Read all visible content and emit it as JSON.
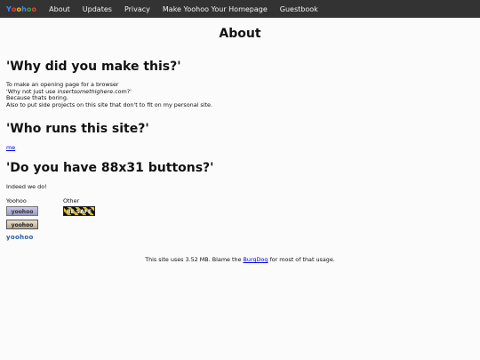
{
  "nav": {
    "brand_letters": [
      "Y",
      "o",
      "o",
      "h",
      "o",
      "o"
    ],
    "brand_colors": [
      "#4285f4",
      "#ea4335",
      "#fbbc05",
      "#4285f4",
      "#34a853",
      "#ea4335"
    ],
    "links": [
      "About",
      "Updates",
      "Privacy",
      "Make Yoohoo Your Homepage",
      "Guestbook"
    ]
  },
  "page_title": "About",
  "sections": {
    "why": {
      "heading": "'Why did you make this?'",
      "line1": "To make an opening page for a browser",
      "line2_prefix": "'Why not just use ",
      "line2_em": "insertsomethighere",
      "line2_suffix": ".com?'",
      "line3": "Because thats boring.",
      "line4": "Also to put side projects on this site that don't to fit on my personal site."
    },
    "who": {
      "heading": "'Who runs this site?'",
      "link": "me"
    },
    "buttons": {
      "heading": "'Do you have 88x31 buttons?'",
      "answer": "Indeed we do!",
      "col1_label": "Yoohoo",
      "col2_label": "Other",
      "yoohoo_buttons": [
        "yoohoo",
        "yoohoo",
        "yoohoo"
      ],
      "other_button": "BE SAFE"
    }
  },
  "footer": {
    "prefix": "This site uses 3.52 MB. Blame the ",
    "link": "BurgDog",
    "suffix": " for most of that usage."
  }
}
